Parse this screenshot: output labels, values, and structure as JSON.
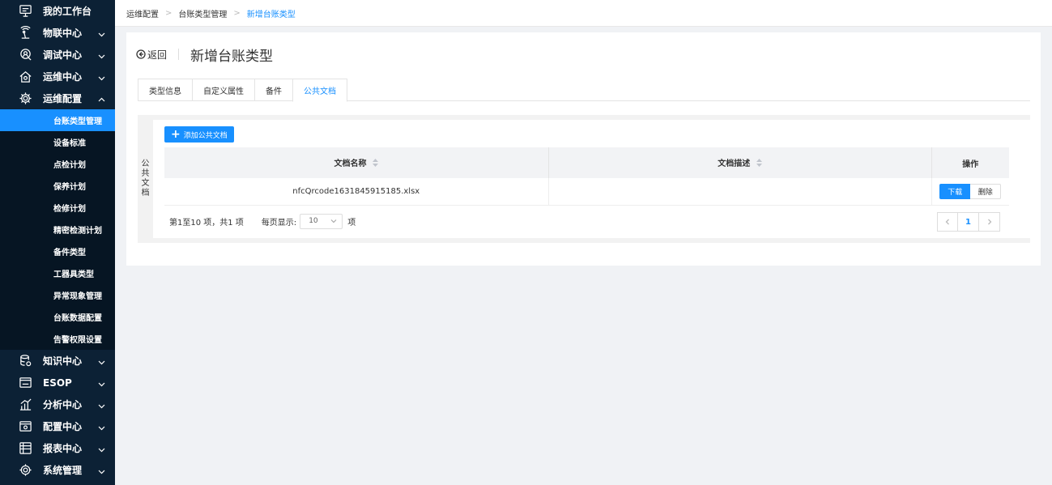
{
  "sidebar": {
    "items_top": [
      {
        "label": "我的工作台",
        "icon": "monitor-icon",
        "has_chevron": false
      },
      {
        "label": "物联中心",
        "icon": "antenna-icon",
        "has_chevron": true
      },
      {
        "label": "调试中心",
        "icon": "debug-icon",
        "has_chevron": true
      },
      {
        "label": "运维中心",
        "icon": "home-wrench-icon",
        "has_chevron": true
      },
      {
        "label": "运维配置",
        "icon": "gear-icon",
        "has_chevron": true,
        "expanded": true
      }
    ],
    "subitems": [
      {
        "label": "台账类型管理",
        "active": true
      },
      {
        "label": "设备标准"
      },
      {
        "label": "点检计划"
      },
      {
        "label": "保养计划"
      },
      {
        "label": "检修计划"
      },
      {
        "label": "精密检测计划"
      },
      {
        "label": "备件类型"
      },
      {
        "label": "工器具类型"
      },
      {
        "label": "异常现象管理"
      },
      {
        "label": "台账数据配置"
      },
      {
        "label": "告警权限设置"
      }
    ],
    "items_bottom": [
      {
        "label": "知识中心",
        "icon": "database-icon",
        "has_chevron": true
      },
      {
        "label": "ESOP",
        "icon": "esop-icon",
        "has_chevron": true
      },
      {
        "label": "分析中心",
        "icon": "bar-chart-icon",
        "has_chevron": true
      },
      {
        "label": "配置中心",
        "icon": "config-icon",
        "has_chevron": true
      },
      {
        "label": "报表中心",
        "icon": "report-icon",
        "has_chevron": true
      },
      {
        "label": "系统管理",
        "icon": "settings-icon",
        "has_chevron": true
      }
    ]
  },
  "breadcrumb": [
    "运维配置",
    "台账类型管理",
    "新增台账类型"
  ],
  "header": {
    "back_label": "返回",
    "title": "新增台账类型"
  },
  "tabs": [
    {
      "label": "类型信息"
    },
    {
      "label": "自定义属性"
    },
    {
      "label": "备件"
    },
    {
      "label": "公共文档",
      "active": true
    }
  ],
  "panel": {
    "side_label": [
      "公",
      "共",
      "文",
      "档"
    ],
    "add_button_label": "添加公共文档",
    "columns": [
      "文档名称",
      "文档描述",
      "操作"
    ],
    "rows": [
      {
        "name": "nfcQrcode1631845915185.xlsx",
        "description": "",
        "download_label": "下载",
        "delete_label": "删除"
      }
    ],
    "pagination": {
      "summary": "第1至10 项，共1 项",
      "page_size_label": "每页显示:",
      "page_size": "10",
      "unit": "项",
      "current_page": "1"
    }
  },
  "colors": {
    "accent": "#1890ff",
    "sidebar_bg": "#0c2135",
    "submenu_bg": "#061523"
  }
}
